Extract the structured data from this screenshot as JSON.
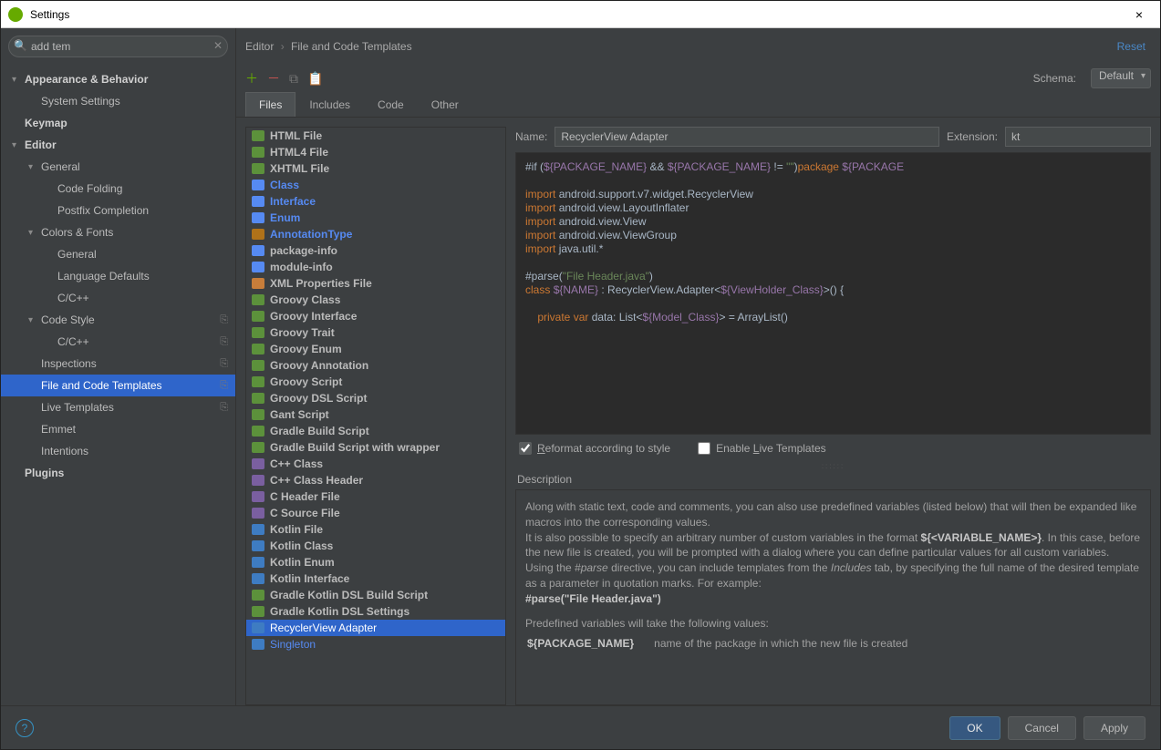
{
  "window": {
    "title": "Settings",
    "close": "×"
  },
  "search": {
    "placeholder": "add tem",
    "value": "add tem"
  },
  "breadcrumb": {
    "a": "Editor",
    "b": "File and Code Templates"
  },
  "reset": "Reset",
  "schema": {
    "label": "Schema:",
    "value": "Default"
  },
  "tabs": [
    "Files",
    "Includes",
    "Code",
    "Other"
  ],
  "sidebar": [
    {
      "label": "Appearance & Behavior",
      "indent": 0,
      "arrow": "▾",
      "bold": true
    },
    {
      "label": "System Settings",
      "indent": 1,
      "arrow": "",
      "bold": false
    },
    {
      "label": "Keymap",
      "indent": 0,
      "arrow": "",
      "bold": true
    },
    {
      "label": "Editor",
      "indent": 0,
      "arrow": "▾",
      "bold": true
    },
    {
      "label": "General",
      "indent": 1,
      "arrow": "▾",
      "bold": false
    },
    {
      "label": "Code Folding",
      "indent": 2,
      "arrow": "",
      "bold": false
    },
    {
      "label": "Postfix Completion",
      "indent": 2,
      "arrow": "",
      "bold": false
    },
    {
      "label": "Colors & Fonts",
      "indent": 1,
      "arrow": "▾",
      "bold": false
    },
    {
      "label": "General",
      "indent": 2,
      "arrow": "",
      "bold": false
    },
    {
      "label": "Language Defaults",
      "indent": 2,
      "arrow": "",
      "bold": false
    },
    {
      "label": "C/C++",
      "indent": 2,
      "arrow": "",
      "bold": false
    },
    {
      "label": "Code Style",
      "indent": 1,
      "arrow": "▾",
      "bold": false,
      "pin": true
    },
    {
      "label": "C/C++",
      "indent": 2,
      "arrow": "",
      "bold": false,
      "pin": true
    },
    {
      "label": "Inspections",
      "indent": 1,
      "arrow": "",
      "bold": false,
      "pin": true
    },
    {
      "label": "File and Code Templates",
      "indent": 1,
      "arrow": "",
      "bold": false,
      "pin": true,
      "selected": true
    },
    {
      "label": "Live Templates",
      "indent": 1,
      "arrow": "",
      "bold": false,
      "pin": true
    },
    {
      "label": "Emmet",
      "indent": 1,
      "arrow": "",
      "bold": false
    },
    {
      "label": "Intentions",
      "indent": 1,
      "arrow": "",
      "bold": false
    },
    {
      "label": "Plugins",
      "indent": 0,
      "arrow": "",
      "bold": true
    }
  ],
  "files": [
    {
      "label": "HTML File",
      "icon": "fi-html",
      "bold": true
    },
    {
      "label": "HTML4 File",
      "icon": "fi-html",
      "bold": true
    },
    {
      "label": "XHTML File",
      "icon": "fi-html",
      "bold": true
    },
    {
      "label": "Class",
      "icon": "fi-class",
      "blue": true,
      "bold": true
    },
    {
      "label": "Interface",
      "icon": "fi-class",
      "blue": true,
      "bold": true
    },
    {
      "label": "Enum",
      "icon": "fi-class",
      "blue": true,
      "bold": true
    },
    {
      "label": "AnnotationType",
      "icon": "fi-ann",
      "blue": true,
      "bold": true
    },
    {
      "label": "package-info",
      "icon": "fi-class",
      "bold": true
    },
    {
      "label": "module-info",
      "icon": "fi-class",
      "bold": true
    },
    {
      "label": "XML Properties File",
      "icon": "fi-xml",
      "bold": true
    },
    {
      "label": "Groovy Class",
      "icon": "fi-groovy",
      "bold": true
    },
    {
      "label": "Groovy Interface",
      "icon": "fi-groovy",
      "bold": true
    },
    {
      "label": "Groovy Trait",
      "icon": "fi-groovy",
      "bold": true
    },
    {
      "label": "Groovy Enum",
      "icon": "fi-groovy",
      "bold": true
    },
    {
      "label": "Groovy Annotation",
      "icon": "fi-groovy",
      "bold": true
    },
    {
      "label": "Groovy Script",
      "icon": "fi-groovy",
      "bold": true
    },
    {
      "label": "Groovy DSL Script",
      "icon": "fi-groovy",
      "bold": true
    },
    {
      "label": "Gant Script",
      "icon": "fi-groovy",
      "bold": true
    },
    {
      "label": "Gradle Build Script",
      "icon": "fi-groovy",
      "bold": true
    },
    {
      "label": "Gradle Build Script with wrapper",
      "icon": "fi-groovy",
      "bold": true
    },
    {
      "label": "C++ Class",
      "icon": "fi-cpp",
      "bold": true
    },
    {
      "label": "C++ Class Header",
      "icon": "fi-cpp",
      "bold": true
    },
    {
      "label": "C Header File",
      "icon": "fi-cpp",
      "bold": true
    },
    {
      "label": "C Source File",
      "icon": "fi-cpp",
      "bold": true
    },
    {
      "label": "Kotlin File",
      "icon": "fi-kt",
      "bold": true
    },
    {
      "label": "Kotlin Class",
      "icon": "fi-kt",
      "bold": true
    },
    {
      "label": "Kotlin Enum",
      "icon": "fi-kt",
      "bold": true
    },
    {
      "label": "Kotlin Interface",
      "icon": "fi-kt",
      "bold": true
    },
    {
      "label": "Gradle Kotlin DSL Build Script",
      "icon": "fi-groovy",
      "bold": true
    },
    {
      "label": "Gradle Kotlin DSL Settings",
      "icon": "fi-groovy",
      "bold": true
    },
    {
      "label": "RecyclerView Adapter",
      "icon": "fi-sel",
      "selected": true
    },
    {
      "label": "Singleton",
      "icon": "fi-kt",
      "blue": true
    }
  ],
  "template": {
    "name_label": "Name:",
    "name": "RecyclerView Adapter",
    "ext_label": "Extension:",
    "ext": "kt"
  },
  "checks": {
    "reformat": "Reformat according to style",
    "live": "Enable Live Templates"
  },
  "desc": {
    "head": "Description",
    "p1": "Along with static text, code and comments, you can also use predefined variables (listed below) that will then be expanded like macros into the corresponding values.",
    "p2a": "It is also possible to specify an arbitrary number of custom variables in the format ",
    "p2b": "${<VARIABLE_NAME>}",
    "p2c": ". In this case, before the new file is created, you will be prompted with a dialog where you can define particular values for all custom variables.",
    "p3a": "Using the ",
    "p3b": "#parse",
    "p3c": " directive, you can include templates from the ",
    "p3d": "Includes",
    "p3e": " tab, by specifying the full name of the desired template as a parameter in quotation marks. For example:",
    "p3f": "#parse(\"File Header.java\")",
    "p4": "Predefined variables will take the following values:",
    "var1": "${PACKAGE_NAME}",
    "var1d": "name of the package in which the new file is created"
  },
  "buttons": {
    "ok": "OK",
    "cancel": "Cancel",
    "apply": "Apply"
  },
  "code": {
    "l1a": "#if (",
    "l1b": "${PACKAGE_NAME}",
    "l1c": " && ",
    "l1d": "${PACKAGE_NAME}",
    "l1e": " != ",
    "l1f": "\"\"",
    "l1g": ")",
    "l1h": "package ",
    "l1i": "${PACKAGE",
    "l2": "import ",
    "l2a": "android.support.v7.widget.RecyclerView",
    "l3": "import ",
    "l3a": "android.view.LayoutInflater",
    "l4": "import ",
    "l4a": "android.view.View",
    "l5": "import ",
    "l5a": "android.view.ViewGroup",
    "l6": "import ",
    "l6a": "java.util.*",
    "l7a": "#parse(",
    "l7b": "\"File Header.java\"",
    "l7c": ")",
    "l8a": "class ",
    "l8b": "${NAME}",
    "l8c": " : RecyclerView.Adapter<",
    "l8d": "${ViewHolder_Class}",
    "l8e": ">() {",
    "l9a": "    private ",
    "l9b": "var ",
    "l9c": "data: List<",
    "l9d": "${Model_Class}",
    "l9e": "> = ArrayList()"
  }
}
